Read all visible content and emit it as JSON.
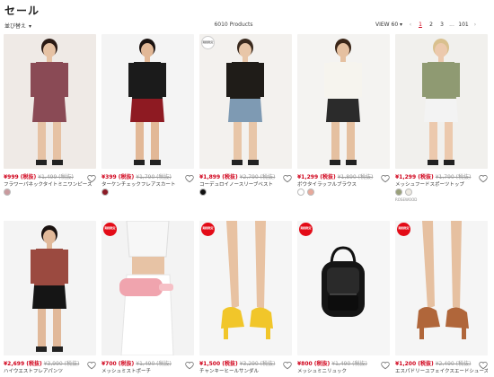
{
  "page": {
    "title": "セール"
  },
  "toolbar": {
    "sort_label": "並び替え",
    "count": "6010 Products",
    "view_label": "VIEW 60",
    "pages": [
      "1",
      "2",
      "3",
      "...",
      "101"
    ],
    "prev": "‹",
    "next": "›"
  },
  "products": [
    {
      "name": "フラワーパネックタイトミニワンピース",
      "price": "¥999 (税抜)",
      "orig": "¥1,499 (税抜)",
      "badge": "",
      "swatches": [
        "#c99a9e"
      ],
      "swatch_caption": "",
      "bg": "#efeae6",
      "top": "#8a4a55",
      "bottom": "#8a4a55",
      "skin": "#e6c2a4",
      "hair": "#2a1a14"
    },
    {
      "name": "ターケンチェックフレアスカート",
      "price": "¥399 (税抜)",
      "orig": "¥1,790 (税抜)",
      "badge": "",
      "swatches": [
        "#8b1a25"
      ],
      "swatch_caption": "",
      "bg": "#f4f4f4",
      "top": "#1b1b1b",
      "bottom": "#8e1a22",
      "skin": "#e2b897",
      "hair": "#1a1210"
    },
    {
      "name": "コーデュロイノースリーブベスト",
      "price": "¥1,899 (税抜)",
      "orig": "¥2,790 (税抜)",
      "badge": "期間限定",
      "badge_plain": true,
      "swatches": [
        "#111111"
      ],
      "swatch_caption": "",
      "bg": "#f3f1ee",
      "top": "#1f1c18",
      "bottom": "#7e9ab3",
      "skin": "#e8c6a8",
      "hair": "#3a2a1e"
    },
    {
      "name": "ボウタイラッフルブラウス",
      "price": "¥1,299 (税抜)",
      "orig": "¥1,890 (税抜)",
      "badge": "",
      "swatches": [
        "#ffffff",
        "#e7a99b"
      ],
      "swatch_caption": "",
      "bg": "#f4f3f1",
      "top": "#f6f4ee",
      "bottom": "#2b2b2b",
      "skin": "#e5c0a0",
      "hair": "#3b2618"
    },
    {
      "name": "メッシュフードスポーツトップ",
      "price": "¥1,299 (税抜)",
      "orig": "¥1,790 (税抜)",
      "badge": "",
      "swatches": [
        "#9aa07a",
        "#eeeae2"
      ],
      "swatch_caption": "ROSEWOOD",
      "bg": "#f1f0ed",
      "top": "#8f9a72",
      "bottom": "#f3f3f3",
      "skin": "#ecc9ad",
      "hair": "#d9c08e"
    },
    {
      "name": "ハイウエストフレアパンツ",
      "price": "¥2,699 (税抜)",
      "orig": "¥3,990 (税抜)",
      "badge": "",
      "swatches": [],
      "swatch_caption": "",
      "bg": "#f4f4f4",
      "top": "#9b4a40",
      "bottom": "#151515",
      "skin": "#e1b99a",
      "hair": "#1a1210"
    },
    {
      "name": "メッシュミストポーチ",
      "price": "¥700 (税抜)",
      "orig": "¥1,490 (税抜)",
      "badge": "期間限定",
      "swatches": [],
      "swatch_caption": "",
      "bg": "#f3f3f3",
      "top": "#f7f7f7",
      "bottom": "#f0a4ae",
      "skin": "#e7c3a5",
      "hair": "#1a1210"
    },
    {
      "name": "チャンキーヒールサンダル",
      "price": "¥1,500 (税抜)",
      "orig": "¥3,290 (税抜)",
      "badge": "期間限定",
      "swatches": [],
      "swatch_caption": "",
      "bg": "#f5f5f5",
      "top": "#e8c2a2",
      "bottom": "#f1c62a",
      "skin": "#e8c2a2",
      "hair": "#000000"
    },
    {
      "name": "メッシュミニリュック",
      "price": "¥800 (税抜)",
      "orig": "¥1,490 (税抜)",
      "badge": "期間限定",
      "swatches": [],
      "swatch_caption": "",
      "bg": "#f6f6f6",
      "top": "#1a1a1a",
      "bottom": "#1a1a1a",
      "skin": "#1a1a1a",
      "hair": "#000000"
    },
    {
      "name": "エスパドリーユフェイクスエードシューズ",
      "price": "¥1,200 (税抜)",
      "orig": "¥2,490 (税抜)",
      "badge": "期間限定",
      "swatches": [],
      "swatch_caption": "",
      "bg": "#f5f5f5",
      "top": "#e6c0a0",
      "bottom": "#b0663a",
      "skin": "#e6c0a0",
      "hair": "#000000"
    }
  ],
  "icons": {
    "heart": "heart-icon",
    "chevron": "chevron-down-icon"
  },
  "colors": {
    "sale_red": "#d0021b",
    "badge_red": "#e30b17"
  }
}
